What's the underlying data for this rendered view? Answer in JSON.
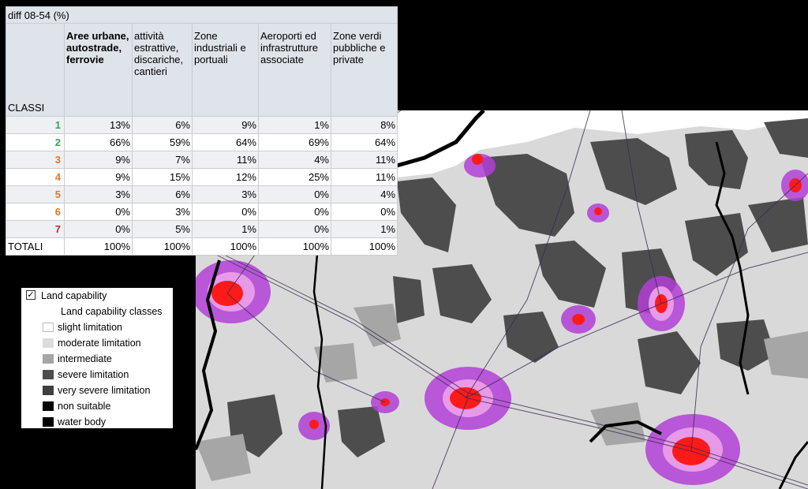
{
  "table": {
    "title": "diff 08-54 (%)",
    "classi_label": "CLASSI",
    "columns": [
      "Aree urbane, autostrade, ferrovie",
      "attività estrattive, discariche, cantieri",
      "Zone industriali e portuali",
      "Aeroporti ed infrastrutture associate",
      "Zone verdi pubbliche e private"
    ],
    "rows": [
      {
        "cls": "1",
        "color": "#2daa4a",
        "values": [
          "13%",
          "6%",
          "9%",
          "1%",
          "8%"
        ]
      },
      {
        "cls": "2",
        "color": "#2daa4a",
        "values": [
          "66%",
          "59%",
          "64%",
          "69%",
          "64%"
        ]
      },
      {
        "cls": "3",
        "color": "#e87722",
        "values": [
          "9%",
          "7%",
          "11%",
          "4%",
          "11%"
        ]
      },
      {
        "cls": "4",
        "color": "#e87722",
        "values": [
          "9%",
          "15%",
          "12%",
          "25%",
          "11%"
        ]
      },
      {
        "cls": "5",
        "color": "#e87722",
        "values": [
          "3%",
          "6%",
          "3%",
          "0%",
          "4%"
        ]
      },
      {
        "cls": "6",
        "color": "#e87722",
        "values": [
          "0%",
          "3%",
          "0%",
          "0%",
          "0%"
        ]
      },
      {
        "cls": "7",
        "color": "#d0261d",
        "values": [
          "0%",
          "5%",
          "1%",
          "0%",
          "1%"
        ]
      }
    ],
    "totals_label": "TOTALI",
    "totals": [
      "100%",
      "100%",
      "100%",
      "100%",
      "100%"
    ]
  },
  "legend": {
    "layer_title": "Land capability",
    "checked": true,
    "group_title": "Land capability classes",
    "items": [
      {
        "label": "slight limitation",
        "color": "#ffffff"
      },
      {
        "label": "moderate limitation",
        "color": "#dcdcdc"
      },
      {
        "label": "intermediate",
        "color": "#a6a6a6"
      },
      {
        "label": "severe limitation",
        "color": "#4d4d4d"
      },
      {
        "label": "very severe limitation",
        "color": "#3f3f3f"
      },
      {
        "label": "non suitable",
        "color": "#050505"
      },
      {
        "label": "water body",
        "color": "#000000"
      }
    ]
  },
  "map": {
    "colors": {
      "background": "#d9d9d9",
      "urban_core": "#ff1a1a",
      "urban_fringe": "#c03ddb",
      "urban_pink": "#e89ae8",
      "severe": "#4d4d4d",
      "intermediate": "#a6a6a6",
      "river": "#000000"
    }
  }
}
